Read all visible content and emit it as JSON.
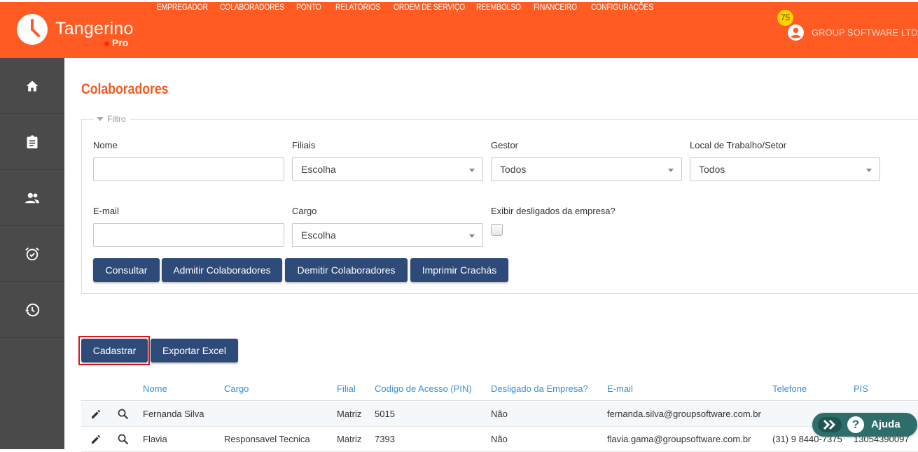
{
  "header": {
    "brand": "Tangerino",
    "brand_sub": "Pro",
    "nav": [
      "EMPREGADOR",
      "COLABORADORES",
      "PONTO",
      "RELATÓRIOS",
      "ORDEM DE SERVIÇO",
      "REEMBOLSO",
      "FINANCEIRO",
      "CONFIGURAÇÕES"
    ],
    "notification_count": "75",
    "company_name": "GROUP SOFTWARE LTD"
  },
  "sidebar": {
    "icons": [
      "home-icon",
      "clipboard-icon",
      "people-icon",
      "alarm-icon",
      "history-icon"
    ]
  },
  "page": {
    "title": "Colaboradores"
  },
  "filter": {
    "legend": "Filtro",
    "nome_label": "Nome",
    "nome_value": "",
    "filiais_label": "Filiais",
    "filiais_value": "Escolha",
    "gestor_label": "Gestor",
    "gestor_value": "Todos",
    "local_label": "Local de Trabalho/Setor",
    "local_value": "Todos",
    "email_label": "E-mail",
    "email_value": "",
    "cargo_label": "Cargo",
    "cargo_value": "Escolha",
    "desligados_label": "Exibir desligados da empresa?",
    "desligados_checked": false,
    "buttons": {
      "consultar": "Consultar",
      "admitir": "Admitir Colaboradores",
      "demitir": "Demitir Colaboradores",
      "imprimir": "Imprimir Crachás"
    }
  },
  "actions": {
    "cadastrar": "Cadastrar",
    "exportar": "Exportar Excel"
  },
  "table": {
    "columns": [
      "Nome",
      "Cargo",
      "Filial",
      "Codigo de Acesso (PIN)",
      "Desligado da Empresa?",
      "E-mail",
      "Telefone",
      "PIS"
    ],
    "rows": [
      {
        "nome": "Fernanda Silva",
        "cargo": "",
        "filial": "Matriz",
        "pin": "5015",
        "desligado": "Não",
        "email": "fernanda.silva@groupsoftware.com.br",
        "telefone": "",
        "pis": ""
      },
      {
        "nome": "Flavia",
        "cargo": "Responsavel Tecnica",
        "filial": "Matriz",
        "pin": "7393",
        "desligado": "Não",
        "email": "flavia.gama@groupsoftware.com.br",
        "telefone": "(31) 9 8440-7375",
        "pis": "13054390097"
      }
    ]
  },
  "help": {
    "label": "Ajuda"
  },
  "colors": {
    "brand_orange": "#ff5b22",
    "title_orange": "#f25a1f",
    "button_navy": "#2e4a78",
    "sidebar": "#4a4a4a",
    "link_blue": "#3a8fd6",
    "help_teal": "#2e6e6a",
    "highlight_red": "#d9161c"
  }
}
